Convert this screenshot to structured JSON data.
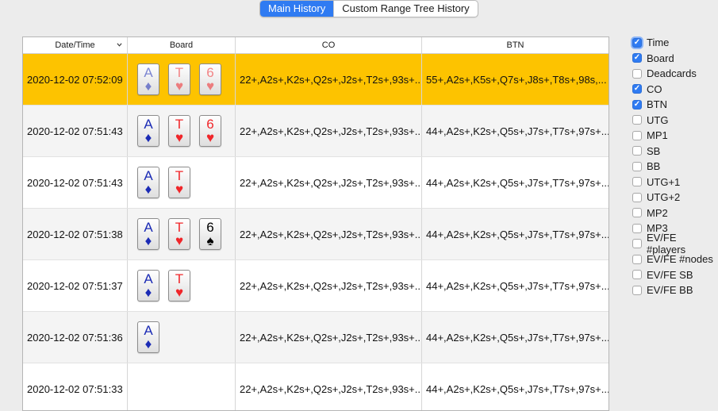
{
  "tabs": [
    {
      "label": "Main History",
      "active": true
    },
    {
      "label": "Custom Range Tree History",
      "active": false
    }
  ],
  "table": {
    "columns": [
      "Date/Time",
      "Board",
      "CO",
      "BTN"
    ],
    "sort_icon": "chevron-down-icon",
    "rows": [
      {
        "datetime": "2020-12-02 07:52:09",
        "selected": true,
        "cards": [
          {
            "rank": "A",
            "suit": "♦",
            "suit_name": "diamond"
          },
          {
            "rank": "T",
            "suit": "♥",
            "suit_name": "heart"
          },
          {
            "rank": "6",
            "suit": "♥",
            "suit_name": "heart"
          }
        ],
        "co": "22+,A2s+,K2s+,Q2s+,J2s+,T2s+,93s+...",
        "btn": "55+,A2s+,K5s+,Q7s+,J8s+,T8s+,98s,..."
      },
      {
        "datetime": "2020-12-02 07:51:43",
        "selected": false,
        "cards": [
          {
            "rank": "A",
            "suit": "♦",
            "suit_name": "diamond"
          },
          {
            "rank": "T",
            "suit": "♥",
            "suit_name": "heart"
          },
          {
            "rank": "6",
            "suit": "♥",
            "suit_name": "heart"
          }
        ],
        "co": "22+,A2s+,K2s+,Q2s+,J2s+,T2s+,93s+...",
        "btn": "44+,A2s+,K2s+,Q5s+,J7s+,T7s+,97s+..."
      },
      {
        "datetime": "2020-12-02 07:51:43",
        "selected": false,
        "cards": [
          {
            "rank": "A",
            "suit": "♦",
            "suit_name": "diamond"
          },
          {
            "rank": "T",
            "suit": "♥",
            "suit_name": "heart"
          }
        ],
        "co": "22+,A2s+,K2s+,Q2s+,J2s+,T2s+,93s+...",
        "btn": "44+,A2s+,K2s+,Q5s+,J7s+,T7s+,97s+..."
      },
      {
        "datetime": "2020-12-02 07:51:38",
        "selected": false,
        "cards": [
          {
            "rank": "A",
            "suit": "♦",
            "suit_name": "diamond"
          },
          {
            "rank": "T",
            "suit": "♥",
            "suit_name": "heart"
          },
          {
            "rank": "6",
            "suit": "♠",
            "suit_name": "spade"
          }
        ],
        "co": "22+,A2s+,K2s+,Q2s+,J2s+,T2s+,93s+...",
        "btn": "44+,A2s+,K2s+,Q5s+,J7s+,T7s+,97s+..."
      },
      {
        "datetime": "2020-12-02 07:51:37",
        "selected": false,
        "cards": [
          {
            "rank": "A",
            "suit": "♦",
            "suit_name": "diamond"
          },
          {
            "rank": "T",
            "suit": "♥",
            "suit_name": "heart"
          }
        ],
        "co": "22+,A2s+,K2s+,Q2s+,J2s+,T2s+,93s+...",
        "btn": "44+,A2s+,K2s+,Q5s+,J7s+,T7s+,97s+..."
      },
      {
        "datetime": "2020-12-02 07:51:36",
        "selected": false,
        "cards": [
          {
            "rank": "A",
            "suit": "♦",
            "suit_name": "diamond"
          }
        ],
        "co": "22+,A2s+,K2s+,Q2s+,J2s+,T2s+,93s+...",
        "btn": "44+,A2s+,K2s+,Q5s+,J7s+,T7s+,97s+..."
      },
      {
        "datetime": "2020-12-02 07:51:33",
        "selected": false,
        "cards": [],
        "co": "22+,A2s+,K2s+,Q2s+,J2s+,T2s+,93s+...",
        "btn": "44+,A2s+,K2s+,Q5s+,J7s+,T7s+,97s+..."
      }
    ]
  },
  "columns_toggle": [
    {
      "label": "Time",
      "checked": true,
      "focused": true
    },
    {
      "label": "Board",
      "checked": true
    },
    {
      "label": "Deadcards",
      "checked": false
    },
    {
      "label": "CO",
      "checked": true
    },
    {
      "label": "BTN",
      "checked": true
    },
    {
      "label": "UTG",
      "checked": false
    },
    {
      "label": "MP1",
      "checked": false
    },
    {
      "label": "SB",
      "checked": false
    },
    {
      "label": "BB",
      "checked": false
    },
    {
      "label": "UTG+1",
      "checked": false
    },
    {
      "label": "UTG+2",
      "checked": false
    },
    {
      "label": "MP2",
      "checked": false
    },
    {
      "label": "MP3",
      "checked": false
    },
    {
      "label": "EV/FE #players",
      "checked": false
    },
    {
      "label": "EV/FE #nodes",
      "checked": false
    },
    {
      "label": "EV/FE SB",
      "checked": false
    },
    {
      "label": "EV/FE BB",
      "checked": false
    }
  ],
  "colors": {
    "accent": "#2f7bf2",
    "selected_row": "#fdc300",
    "diamond": "#1b2bb5",
    "heart": "#f0262a",
    "spade": "#000000"
  }
}
